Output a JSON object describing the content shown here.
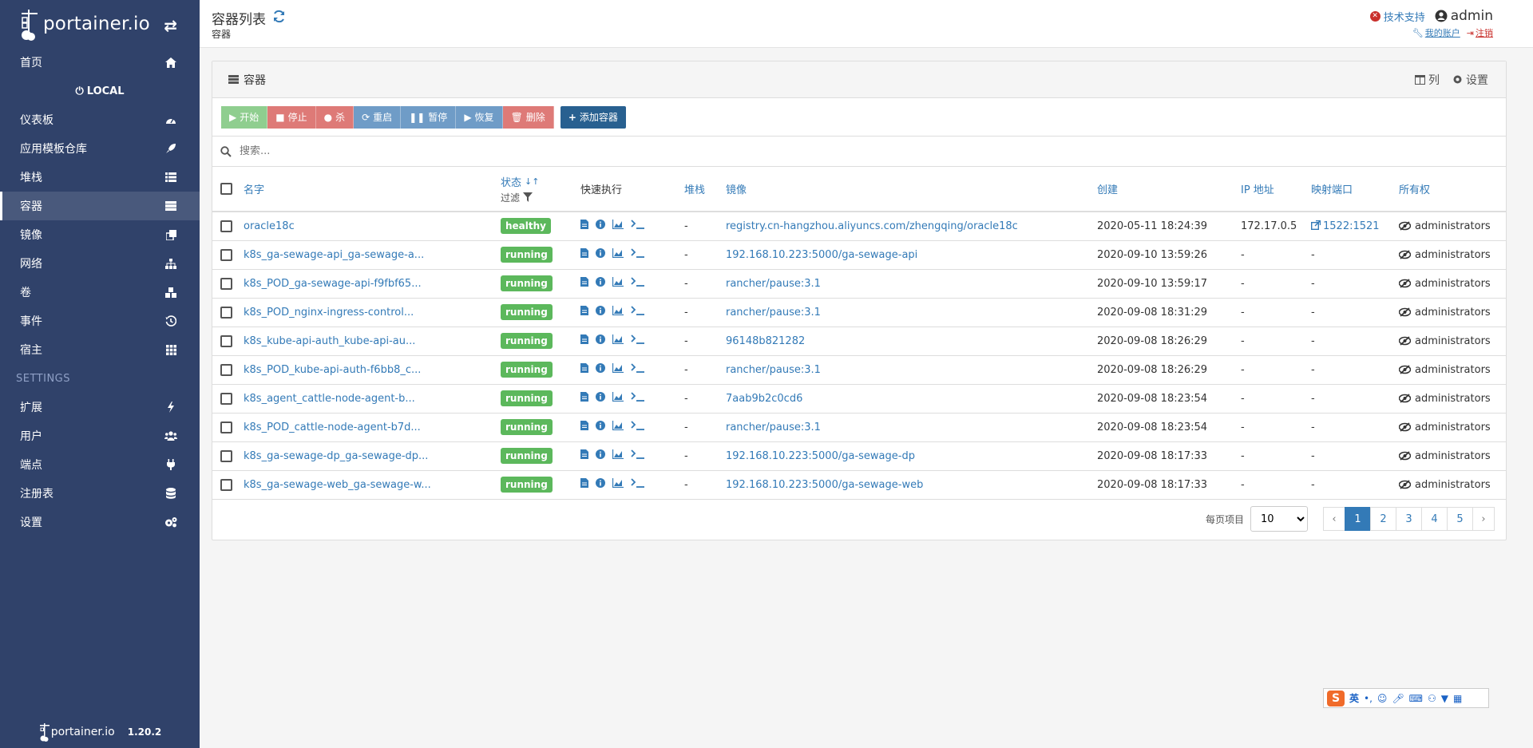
{
  "app": {
    "name": "portainer.io",
    "version": "1.20.2"
  },
  "sidebar": {
    "home": "首页",
    "endpoint": "LOCAL",
    "items": [
      {
        "label": "仪表板",
        "icon": "tachometer-icon"
      },
      {
        "label": "应用模板仓库",
        "icon": "rocket-icon"
      },
      {
        "label": "堆栈",
        "icon": "th-list-icon"
      },
      {
        "label": "容器",
        "icon": "server-icon"
      },
      {
        "label": "镜像",
        "icon": "clone-icon"
      },
      {
        "label": "网络",
        "icon": "sitemap-icon"
      },
      {
        "label": "卷",
        "icon": "cubes-icon"
      },
      {
        "label": "事件",
        "icon": "history-icon"
      },
      {
        "label": "宿主",
        "icon": "th-icon"
      }
    ],
    "settings_header": "SETTINGS",
    "settings_items": [
      {
        "label": "扩展",
        "icon": "bolt-icon"
      },
      {
        "label": "用户",
        "icon": "users-icon"
      },
      {
        "label": "端点",
        "icon": "plug-icon"
      },
      {
        "label": "注册表",
        "icon": "database-icon"
      },
      {
        "label": "设置",
        "icon": "cogs-icon"
      }
    ]
  },
  "header": {
    "title": "容器列表",
    "breadcrumb": "容器",
    "support": "技术支持",
    "user": "admin",
    "my_account": "我的账户",
    "logout": "注销"
  },
  "panel": {
    "title": "容器",
    "columns_label": "列",
    "settings_label": "设置"
  },
  "toolbar": {
    "start": "开始",
    "stop": "停止",
    "kill": "杀",
    "restart": "重启",
    "pause": "暂停",
    "resume": "恢复",
    "remove": "删除",
    "add": "添加容器"
  },
  "search": {
    "placeholder": "搜索..."
  },
  "table": {
    "headers": {
      "name": "名字",
      "state": "状态",
      "filter": "过滤",
      "quick_actions": "快速执行",
      "stack": "堆栈",
      "image": "镜像",
      "created": "创建",
      "ip": "IP 地址",
      "ports": "映射端口",
      "ownership": "所有权"
    },
    "rows": [
      {
        "name": "oracle18c",
        "state": "healthy",
        "stack": "-",
        "image": "registry.cn-hangzhou.aliyuncs.com/zhengqing/oracle18c",
        "created": "2020-05-11 18:24:39",
        "ip": "172.17.0.5",
        "ports": "1522:1521",
        "owner": "administrators"
      },
      {
        "name": "k8s_ga-sewage-api_ga-sewage-a...",
        "state": "running",
        "stack": "-",
        "image": "192.168.10.223:5000/ga-sewage-api",
        "created": "2020-09-10 13:59:26",
        "ip": "-",
        "ports": "-",
        "owner": "administrators"
      },
      {
        "name": "k8s_POD_ga-sewage-api-f9fbf65...",
        "state": "running",
        "stack": "-",
        "image": "rancher/pause:3.1",
        "created": "2020-09-10 13:59:17",
        "ip": "-",
        "ports": "-",
        "owner": "administrators"
      },
      {
        "name": "k8s_POD_nginx-ingress-control...",
        "state": "running",
        "stack": "-",
        "image": "rancher/pause:3.1",
        "created": "2020-09-08 18:31:29",
        "ip": "-",
        "ports": "-",
        "owner": "administrators"
      },
      {
        "name": "k8s_kube-api-auth_kube-api-au...",
        "state": "running",
        "stack": "-",
        "image": "96148b821282",
        "created": "2020-09-08 18:26:29",
        "ip": "-",
        "ports": "-",
        "owner": "administrators"
      },
      {
        "name": "k8s_POD_kube-api-auth-f6bb8_c...",
        "state": "running",
        "stack": "-",
        "image": "rancher/pause:3.1",
        "created": "2020-09-08 18:26:29",
        "ip": "-",
        "ports": "-",
        "owner": "administrators"
      },
      {
        "name": "k8s_agent_cattle-node-agent-b...",
        "state": "running",
        "stack": "-",
        "image": "7aab9b2c0cd6",
        "created": "2020-09-08 18:23:54",
        "ip": "-",
        "ports": "-",
        "owner": "administrators"
      },
      {
        "name": "k8s_POD_cattle-node-agent-b7d...",
        "state": "running",
        "stack": "-",
        "image": "rancher/pause:3.1",
        "created": "2020-09-08 18:23:54",
        "ip": "-",
        "ports": "-",
        "owner": "administrators"
      },
      {
        "name": "k8s_ga-sewage-dp_ga-sewage-dp...",
        "state": "running",
        "stack": "-",
        "image": "192.168.10.223:5000/ga-sewage-dp",
        "created": "2020-09-08 18:17:33",
        "ip": "-",
        "ports": "-",
        "owner": "administrators"
      },
      {
        "name": "k8s_ga-sewage-web_ga-sewage-w...",
        "state": "running",
        "stack": "-",
        "image": "192.168.10.223:5000/ga-sewage-web",
        "created": "2020-09-08 18:17:33",
        "ip": "-",
        "ports": "-",
        "owner": "administrators"
      }
    ]
  },
  "pagination": {
    "items_per_page_label": "每页项目",
    "items_per_page": "10",
    "pages": [
      "1",
      "2",
      "3",
      "4",
      "5"
    ],
    "prev": "‹",
    "next": "›",
    "current": "1"
  },
  "ime": {
    "mode": "英",
    "punct": "•,"
  },
  "colors": {
    "sidebar": "#30426a",
    "link": "#337ab7",
    "badge": "#5cb85c"
  }
}
